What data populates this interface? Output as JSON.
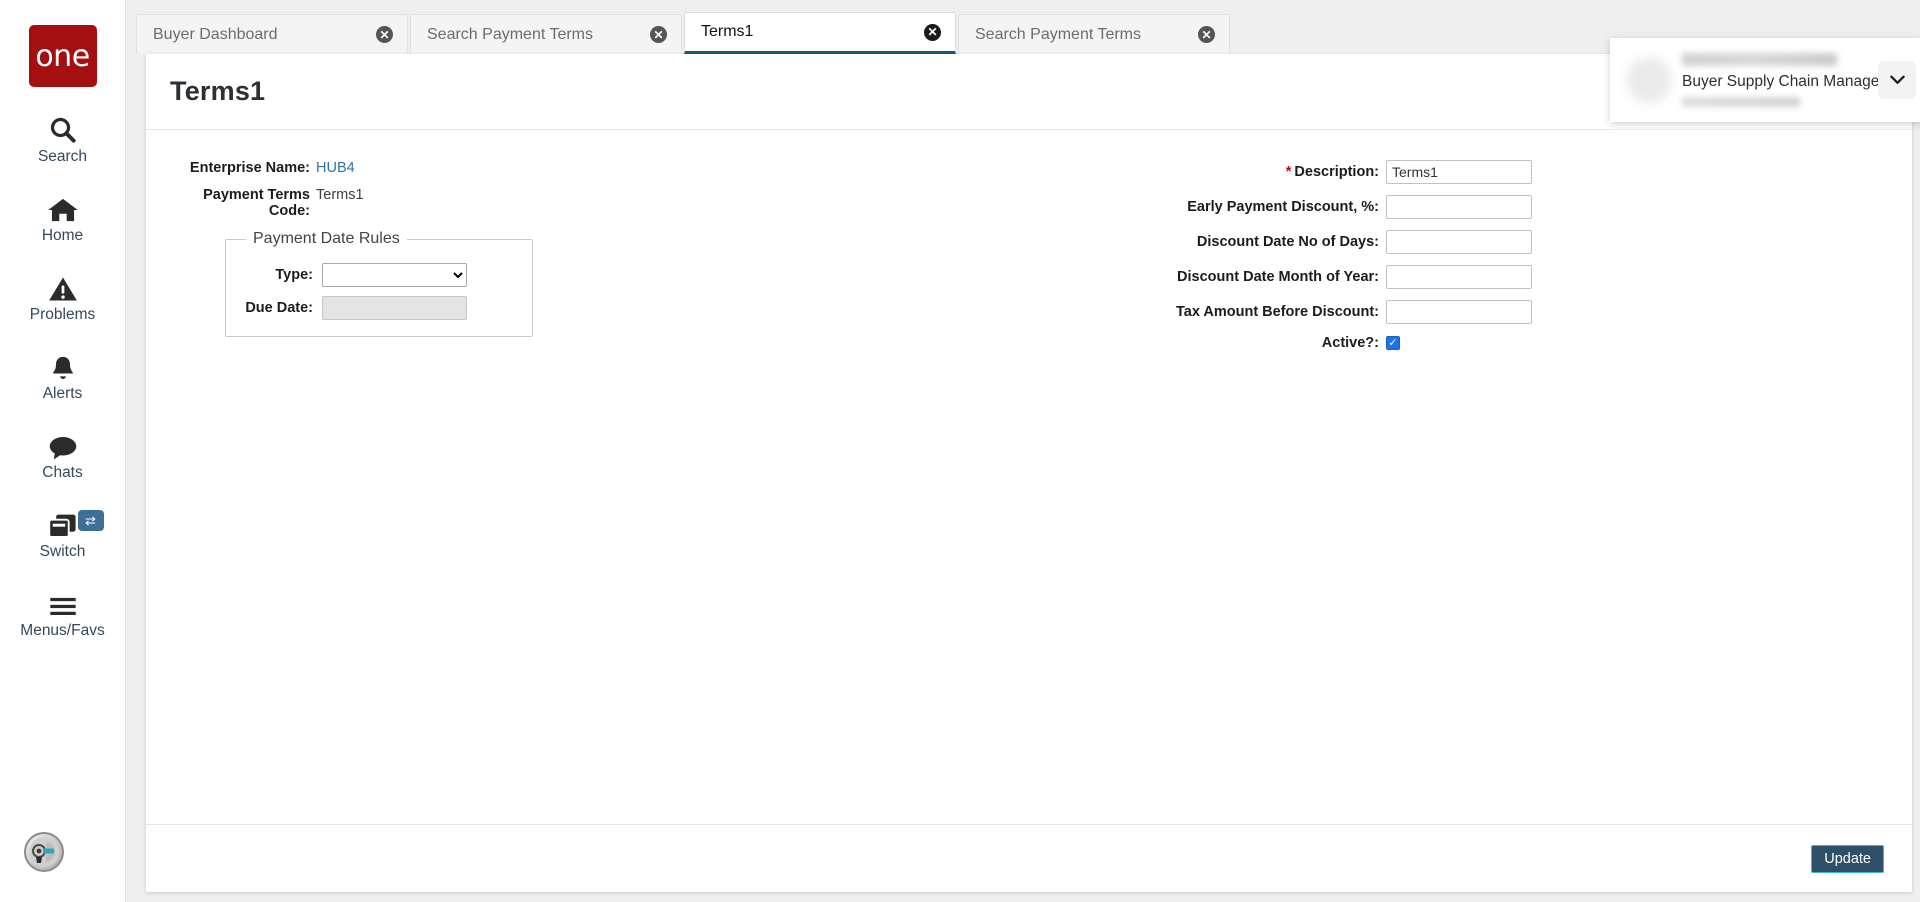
{
  "sidebar": {
    "logo_text": "one",
    "items": [
      {
        "label": "Search",
        "icon": "search-icon"
      },
      {
        "label": "Home",
        "icon": "home-icon"
      },
      {
        "label": "Problems",
        "icon": "warning-triangle-icon"
      },
      {
        "label": "Alerts",
        "icon": "bell-icon"
      },
      {
        "label": "Chats",
        "icon": "chat-bubble-icon"
      },
      {
        "label": "Switch",
        "icon": "windows-stack-icon",
        "badge_icon": "swap-arrows-icon"
      },
      {
        "label": "Menus/Favs",
        "icon": "hamburger-icon"
      }
    ],
    "bot_avatar_icon": "robot-avatar-icon"
  },
  "tabs": [
    {
      "label": "Buyer Dashboard",
      "active": false
    },
    {
      "label": "Search Payment Terms",
      "active": false
    },
    {
      "label": "Terms1",
      "active": true
    },
    {
      "label": "Search Payment Terms",
      "active": false
    }
  ],
  "header": {
    "title": "Terms1",
    "refresh_icon": "refresh-icon",
    "close_icon": "close-x-icon",
    "menu_icon": "hamburger-menu-icon",
    "badge_icon": "star-icon",
    "user": {
      "role": "Buyer Supply Chain Manager",
      "dropdown_icon": "chevron-down-icon"
    }
  },
  "form": {
    "enterprise_name_label": "Enterprise Name:",
    "enterprise_name_value": "HUB4",
    "payment_terms_code_label": "Payment Terms Code:",
    "payment_terms_code_value": "Terms1",
    "rules": {
      "legend": "Payment Date Rules",
      "type_label": "Type:",
      "type_value": "",
      "due_date_label": "Due Date:",
      "due_date_value": ""
    },
    "right_fields": [
      {
        "label": "Description:",
        "value": "Terms1",
        "required": true,
        "type": "text"
      },
      {
        "label": "Early Payment Discount, %:",
        "value": "",
        "required": false,
        "type": "text"
      },
      {
        "label": "Discount Date No of Days:",
        "value": "",
        "required": false,
        "type": "text"
      },
      {
        "label": "Discount Date Month of Year:",
        "value": "",
        "required": false,
        "type": "text"
      },
      {
        "label": "Tax Amount Before Discount:",
        "value": "",
        "required": false,
        "type": "text"
      }
    ],
    "active_label": "Active?:",
    "active_checked": true
  },
  "footer": {
    "update_label": "Update"
  },
  "colors": {
    "brand_red": "#a40f12",
    "teal_button": "#0b6172",
    "active_tab_underline": "#11626e",
    "link_blue": "#2f73a8",
    "required_red": "#b5121b",
    "checkbox_blue": "#1a73e8",
    "update_button_bg": "#2d4f68",
    "update_button_border": "#3fb4c9",
    "badge_red": "#c1121f"
  }
}
